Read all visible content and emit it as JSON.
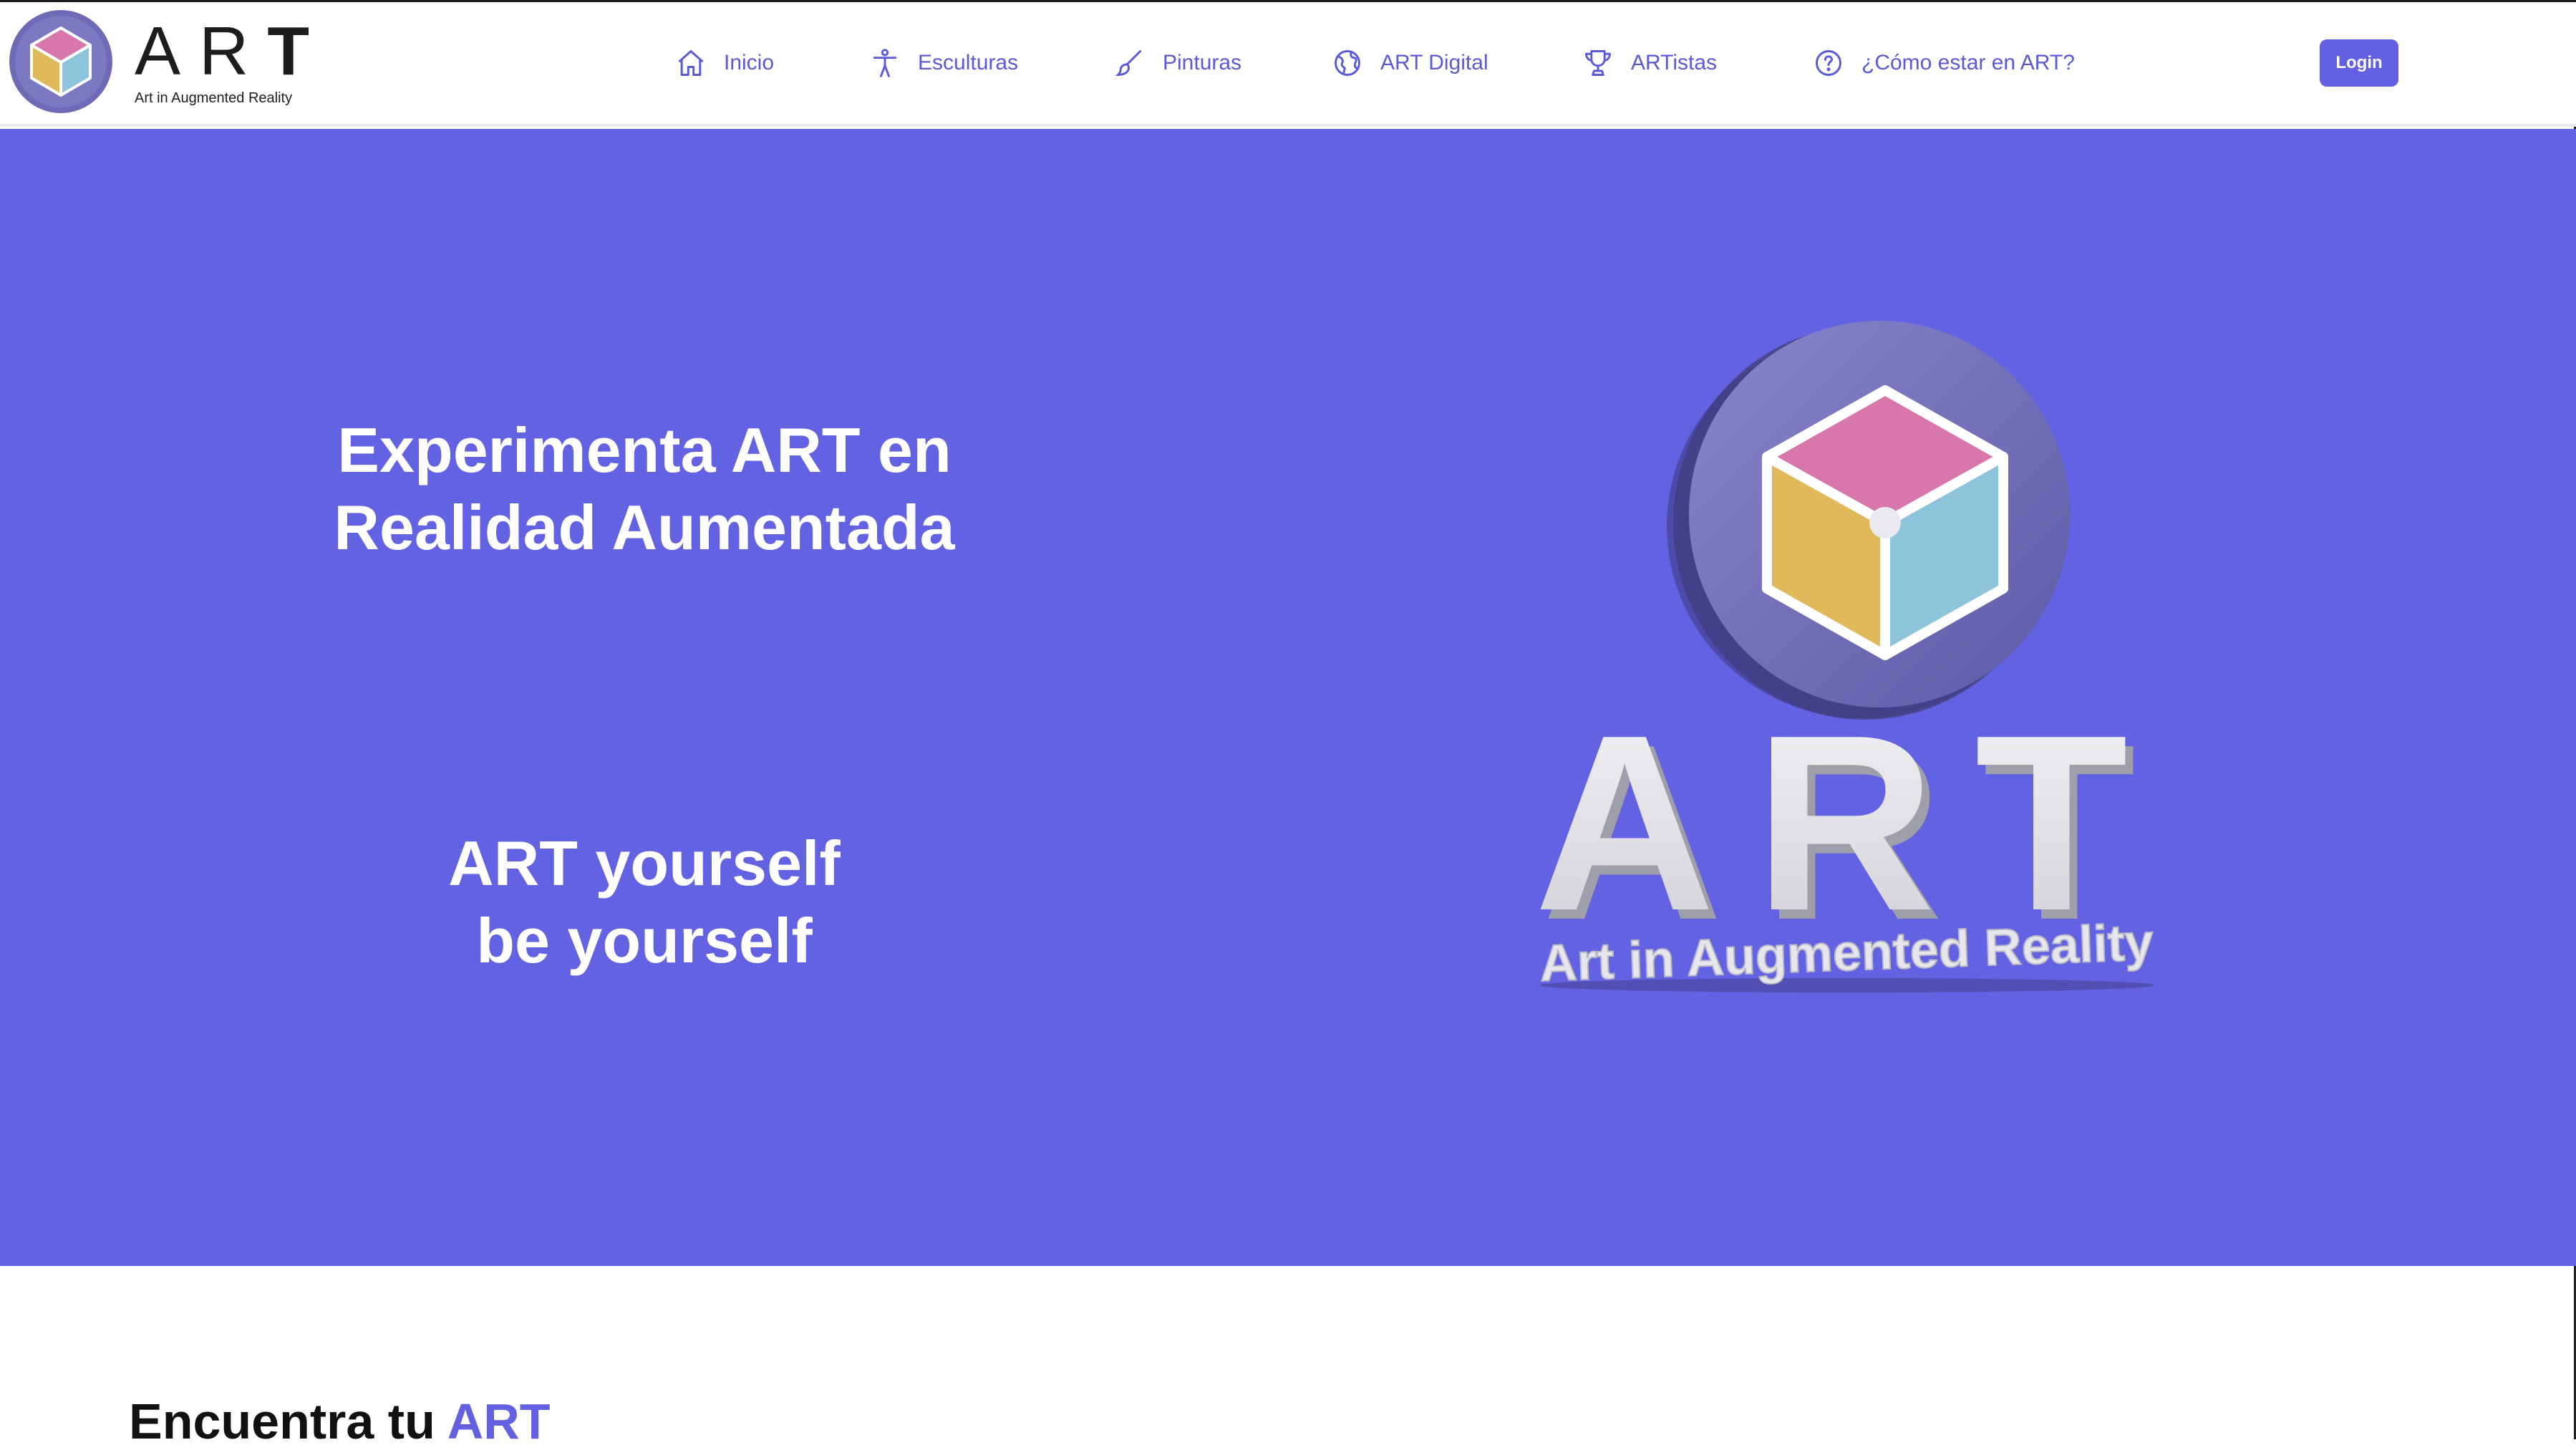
{
  "brand": {
    "word": "AR",
    "word_last": "T",
    "tagline": "Art in Augmented Reality"
  },
  "nav": {
    "items": [
      {
        "label": "Inicio",
        "icon": "home-icon"
      },
      {
        "label": "Esculturas",
        "icon": "person-icon"
      },
      {
        "label": "Pinturas",
        "icon": "brush-icon"
      },
      {
        "label": "ART Digital",
        "icon": "globe-icon"
      },
      {
        "label": "ARTistas",
        "icon": "trophy-icon"
      },
      {
        "label": "¿Cómo estar en ART?",
        "icon": "help-circle-icon"
      }
    ],
    "login_label": "Login"
  },
  "hero": {
    "heading_line1": "Experimenta ART en",
    "heading_line2": "Realidad Aumentada",
    "sub_line1": "ART yourself",
    "sub_line2": "be yourself",
    "art_text": "ART",
    "art_tagline": "Art in Augmented Reality"
  },
  "section": {
    "title_prefix": "Encuentra tu ",
    "title_accent": "ART"
  },
  "colors": {
    "accent": "#6361e1",
    "hero_bg": "#6362e2",
    "cube_top": "#d877ac",
    "cube_left": "#dfb95a",
    "cube_right": "#8ec3dc"
  }
}
